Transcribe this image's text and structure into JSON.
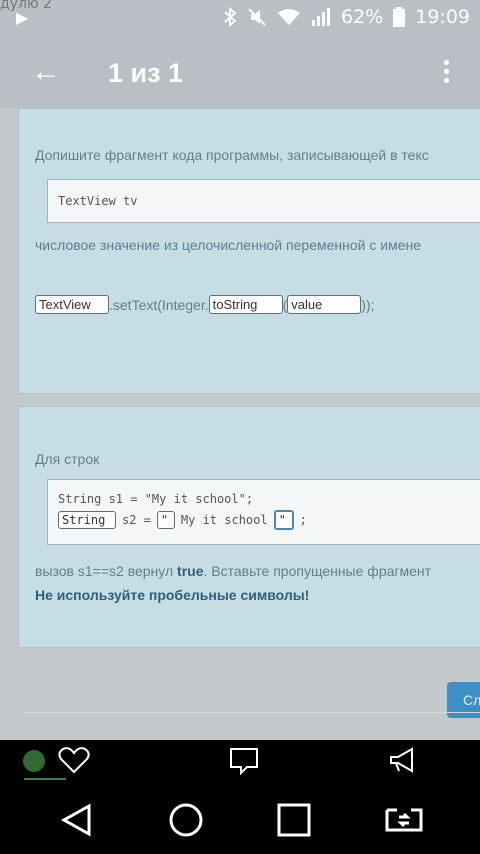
{
  "status": {
    "ghost_text": "дулю 2",
    "battery": "62%",
    "time": "19:09"
  },
  "toolbar": {
    "title": "1 из 1"
  },
  "card1": {
    "prompt": "Допишите фрагмент кода программы, записывающей в текс",
    "code": "TextView tv",
    "prompt2": "числовое значение из целочисленной переменной с имене",
    "blank1": "TextView",
    "mid1": ".setText(Integer.",
    "blank2": "toString",
    "mid2": "(",
    "blank3": "value",
    "end": "));"
  },
  "card2": {
    "prompt": "Для строк",
    "code_line1": "String s1 = \"My it school\";",
    "blank1": "String",
    "mid1": "s2 =",
    "blank2": "\"",
    "mid2": "My it school",
    "blank3": "\"",
    "end": ";",
    "text_before": "вызов s1==s2 вернул ",
    "text_bold": "true",
    "text_after": ". Вставьте пропущенные фрагмент",
    "warning": "Не используйте пробельные символы!"
  },
  "next_button_label": "Сл"
}
